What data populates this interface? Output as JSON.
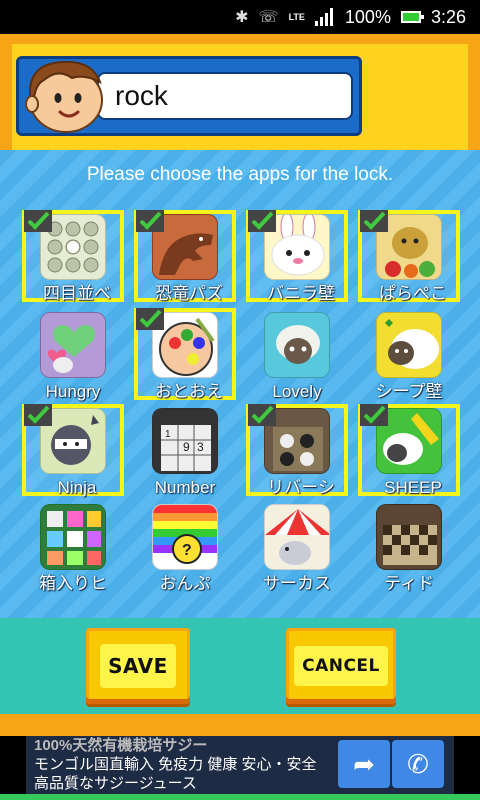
{
  "status_bar": {
    "bluetooth_icon": "bluetooth-icon",
    "vibrate_icon": "vibrate-icon",
    "network": "LTE",
    "battery": "100%",
    "time": "3:26"
  },
  "header": {
    "profile_name": "rock"
  },
  "instruction": "Please choose the apps for the lock.",
  "apps": [
    {
      "label": "四目並べ",
      "selected": true
    },
    {
      "label": "恐竜パズ",
      "selected": true
    },
    {
      "label": "バニラ壁",
      "selected": true
    },
    {
      "label": "ぱらぺこ",
      "selected": true
    },
    {
      "label": "Hungry",
      "selected": false
    },
    {
      "label": "おとおえ",
      "selected": true
    },
    {
      "label": "Lovely",
      "selected": false
    },
    {
      "label": "シープ壁",
      "selected": false
    },
    {
      "label": "Ninja",
      "selected": true
    },
    {
      "label": "Number",
      "selected": false
    },
    {
      "label": "リバーシ",
      "selected": true
    },
    {
      "label": "SHEEP",
      "selected": true
    },
    {
      "label": "箱入りヒ",
      "selected": false
    },
    {
      "label": "おんぷ",
      "selected": false
    },
    {
      "label": "サーカス",
      "selected": false
    },
    {
      "label": "ティド",
      "selected": false
    }
  ],
  "buttons": {
    "save": "SAVE",
    "cancel": "CANCEL"
  },
  "ad": {
    "line1": "100%天然有機栽培サジー",
    "line2": "モンゴル国直輸入 免疫力 健康 安心・安全",
    "line3": "高品質なサジージュース"
  }
}
